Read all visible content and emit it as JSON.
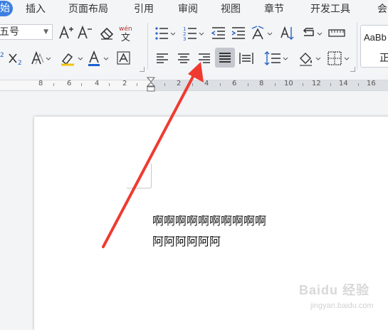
{
  "menubar": {
    "home_tab": "始",
    "items": [
      "插入",
      "页面布局",
      "引用",
      "审阅",
      "视图",
      "章节",
      "开发工具",
      "会"
    ]
  },
  "ribbon": {
    "font_size": "五号",
    "style_sample": "AaBb",
    "style_name": "正",
    "text_color": "#1b5fd6",
    "highlight_color": "#f2c40d",
    "active_button": "justify-align-button"
  },
  "ruler": {
    "labels": [
      "8",
      "6",
      "4",
      "2",
      "2",
      "4",
      "6",
      "8",
      "10",
      "12",
      "14",
      "16"
    ]
  },
  "document": {
    "lines": [
      "啊啊啊啊啊啊啊啊啊啊",
      "阿阿阿阿阿阿"
    ]
  },
  "watermark": {
    "logo": "Baidu 经验",
    "url": "jingyan.baidu.com"
  },
  "annotation": {
    "arrow_color": "#f03a30"
  }
}
